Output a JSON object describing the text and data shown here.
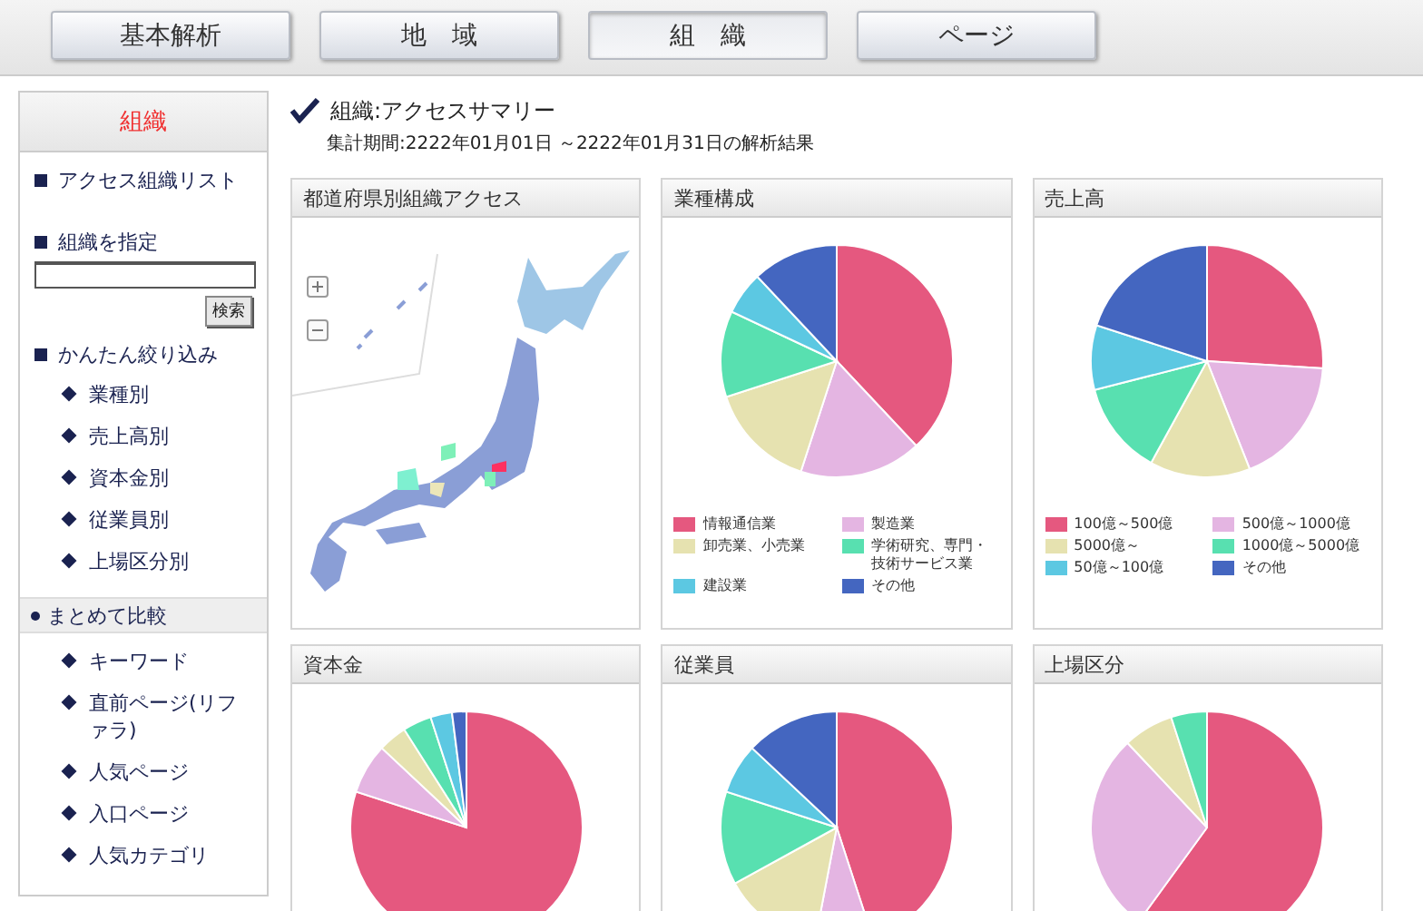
{
  "tabs": [
    {
      "label": "基本解析",
      "selected": false
    },
    {
      "label": "地　域",
      "selected": false
    },
    {
      "label": "組　織",
      "selected": true
    },
    {
      "label": "ページ",
      "selected": false
    }
  ],
  "sidebar": {
    "title": "組織",
    "access_list": "アクセス組織リスト",
    "search": {
      "label": "組織を指定",
      "button": "検索"
    },
    "filter": {
      "label": "かんたん絞り込み",
      "items": [
        "業種別",
        "売上高別",
        "資本金別",
        "従業員別",
        "上場区分別"
      ]
    },
    "compare": {
      "label": "まとめて比較",
      "items": [
        "キーワード",
        "直前ページ(リファラ)",
        "人気ページ",
        "入口ページ",
        "人気カテゴリ"
      ]
    }
  },
  "heading": {
    "checked": true,
    "title": "組織:アクセスサマリー",
    "period": "集計期間:2222年01月01日 ～2222年01月31日の解析結果"
  },
  "panels": [
    {
      "kind": "map",
      "title": "都道府県別組織アクセス"
    },
    {
      "kind": "pie",
      "title": "業種構成",
      "legend": [
        {
          "label": "情報通信業",
          "color": "#e5587f"
        },
        {
          "label": "製造業",
          "color": "#e4b5e2"
        },
        {
          "label": "卸売業、小売業",
          "color": "#e6e2b0"
        },
        {
          "label": "学術研究、専門・技術サービス業",
          "color": "#58e0b0"
        },
        {
          "label": "建設業",
          "color": "#5cc8e2"
        },
        {
          "label": "その他",
          "color": "#4466c0"
        }
      ]
    },
    {
      "kind": "pie",
      "title": "売上高",
      "legend": [
        {
          "label": "100億～500億",
          "color": "#e5587f"
        },
        {
          "label": "500億～1000億",
          "color": "#e4b5e2"
        },
        {
          "label": "5000億～",
          "color": "#e6e2b0"
        },
        {
          "label": "1000億～5000億",
          "color": "#58e0b0"
        },
        {
          "label": "50億～100億",
          "color": "#5cc8e2"
        },
        {
          "label": "その他",
          "color": "#4466c0"
        }
      ]
    },
    {
      "kind": "pie",
      "title": "資本金"
    },
    {
      "kind": "pie",
      "title": "従業員"
    },
    {
      "kind": "pie",
      "title": "上場区分"
    }
  ]
}
